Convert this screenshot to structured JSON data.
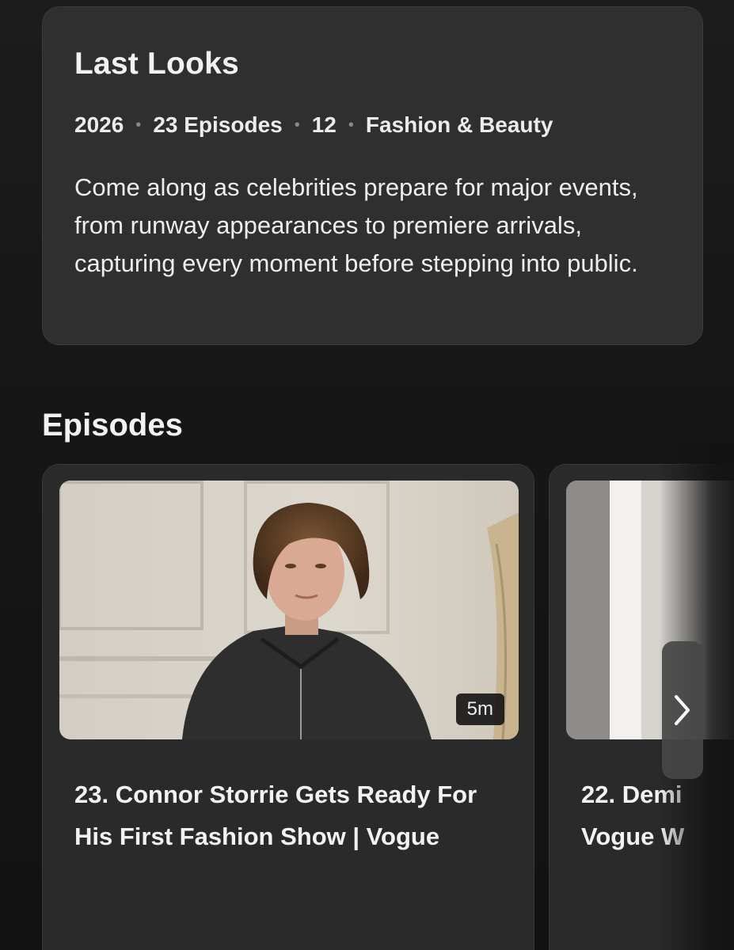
{
  "show": {
    "title": "Last Looks",
    "meta": {
      "year": "2026",
      "episodes": "23 Episodes",
      "rating": "12",
      "genre": "Fashion & Beauty"
    },
    "description": "Come along as celebrities prepare for major events, from runway appearances to premiere arrivals, capturing every moment before stepping into public."
  },
  "episodes_section": {
    "title": "Episodes",
    "items": [
      {
        "title": "23. Connor Storrie Gets Ready For His First Fashion Show | Vogue",
        "duration": "5m",
        "thumbnail_icon": "episode-thumbnail-image"
      },
      {
        "title_line1": "22. Demi",
        "title_line2": "Vogue W",
        "thumbnail_icon": "episode-thumbnail-image"
      }
    ],
    "next_icon": "chevron-right-icon"
  }
}
